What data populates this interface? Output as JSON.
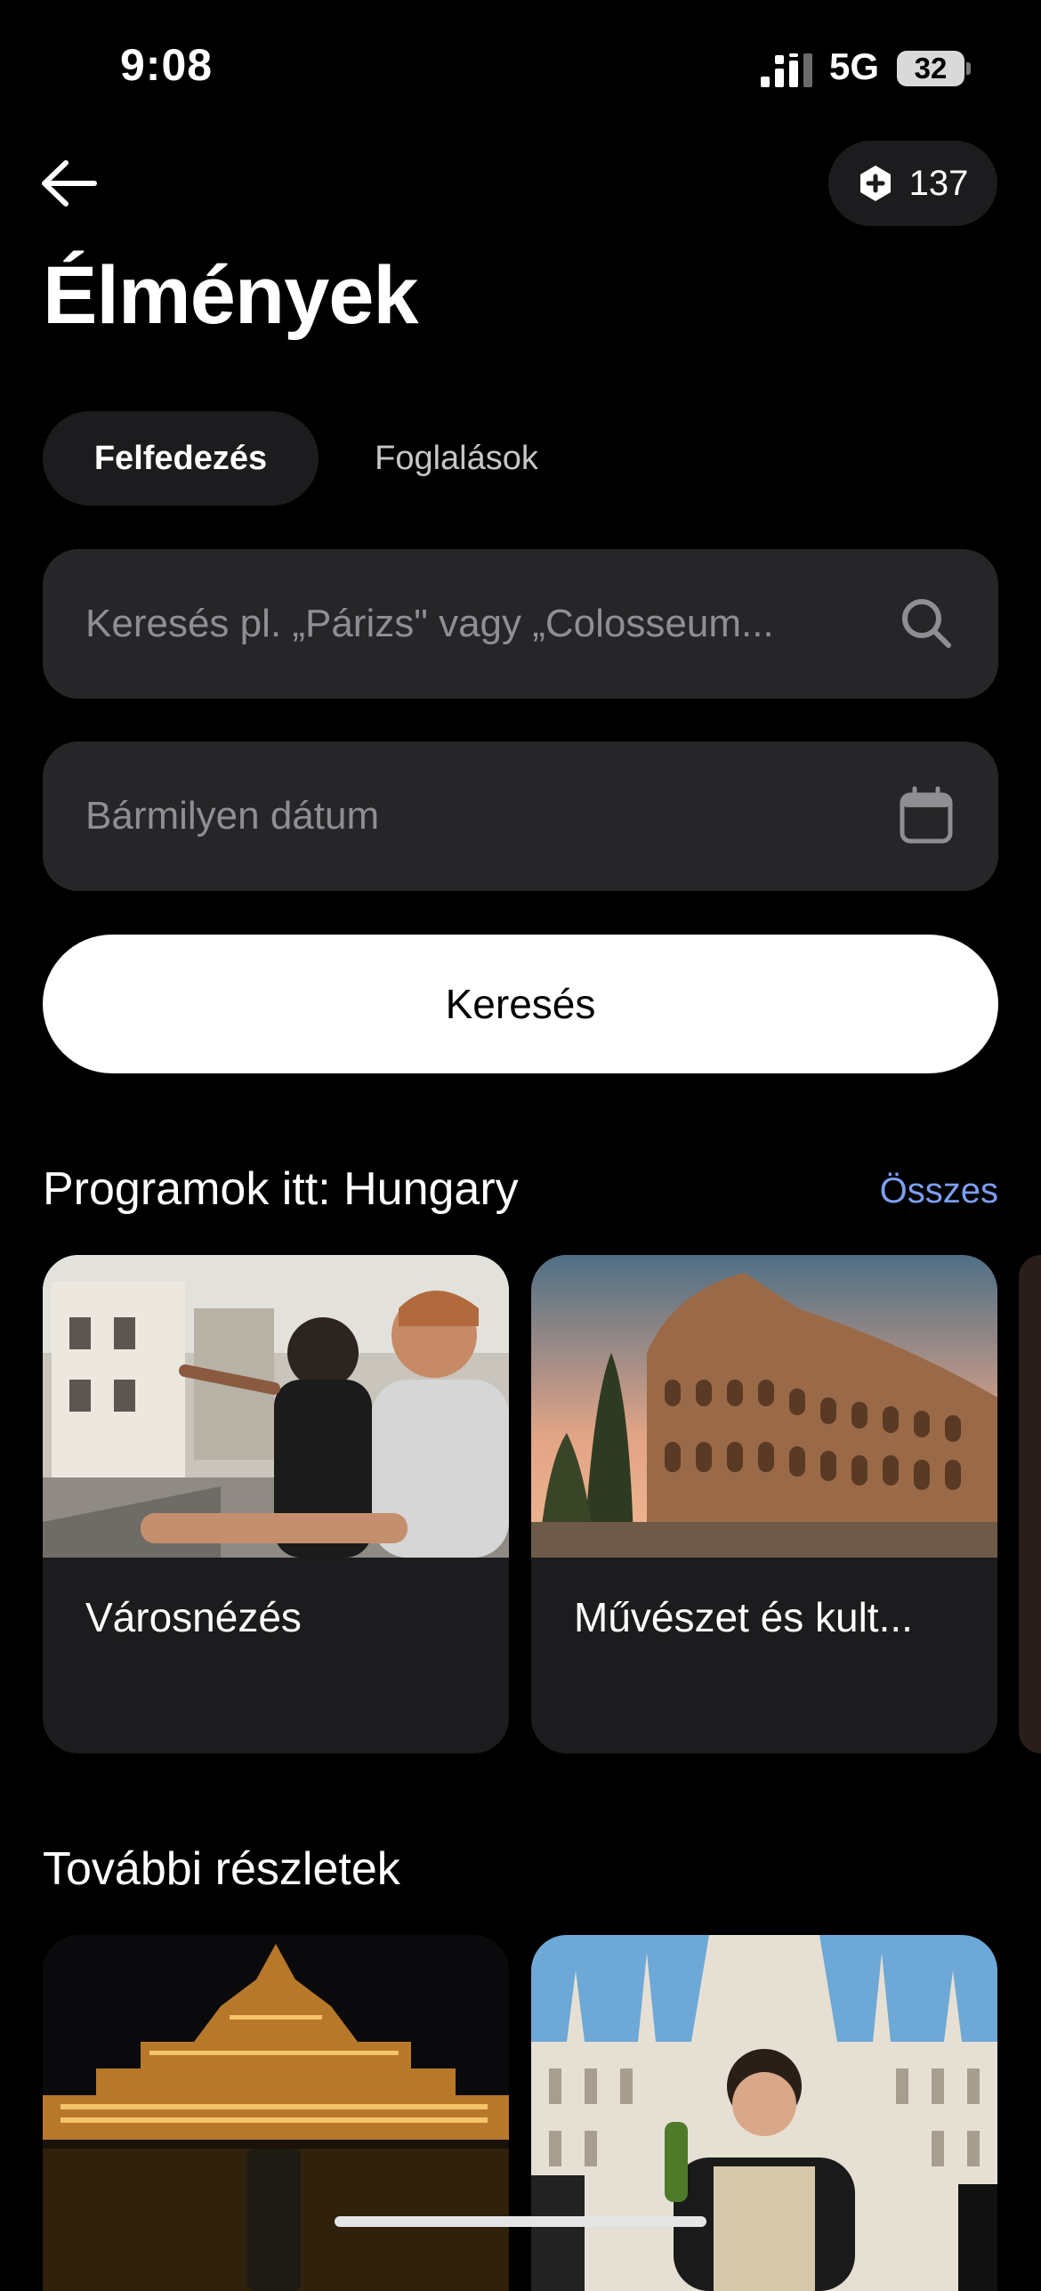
{
  "status_bar": {
    "time": "9:08",
    "network": "5G",
    "battery": "32"
  },
  "header": {
    "points": "137"
  },
  "page_title": "Élmények",
  "tabs": [
    {
      "label": "Felfedezés",
      "active": true
    },
    {
      "label": "Foglalások",
      "active": false
    }
  ],
  "search": {
    "placeholder": "Keresés pl. „Párizs\" vagy „Colosseum..."
  },
  "date": {
    "placeholder": "Bármilyen dátum"
  },
  "search_button": "Keresés",
  "section_programs": {
    "title": "Programok itt: Hungary",
    "see_all": "Összes",
    "cards": [
      {
        "label": "Városnézés"
      },
      {
        "label": "Művészet és kult..."
      }
    ]
  },
  "section_more": {
    "title": "További részletek"
  },
  "icons": {
    "back": "arrow-left-icon",
    "points": "hexagon-plus-icon",
    "search": "search-icon",
    "date": "calendar-icon"
  },
  "colors": {
    "background": "#000000",
    "surface": "#1c1c1e",
    "input": "#262628",
    "link": "#7c9ef0"
  }
}
